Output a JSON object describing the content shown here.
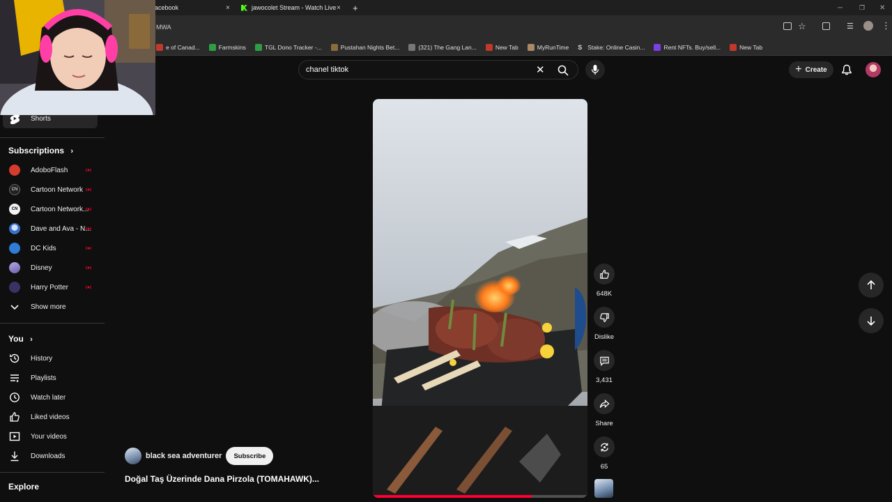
{
  "browser": {
    "tabs": [
      {
        "label": "acebook",
        "close": "×"
      },
      {
        "label": "jawocolet Stream - Watch Live",
        "close": "×"
      }
    ],
    "new_tab": "+",
    "address_partial": "MWA",
    "bookmarks": [
      {
        "label": "e of Canad...",
        "color": "#c0392b"
      },
      {
        "label": "Farmskins",
        "color": "#2e9e45"
      },
      {
        "label": "TGL Dono Tracker -...",
        "color": "#2e9e45"
      },
      {
        "label": "Pustahan Nights Bet...",
        "color": "#8a6d3b"
      },
      {
        "label": "(321) The Gang Lan...",
        "color": "#777777"
      },
      {
        "label": "New Tab",
        "color": "#c0392b"
      },
      {
        "label": "MyRunTime",
        "color": "#aa8866"
      },
      {
        "label": "Stake: Online Casin...",
        "color": "#dddddd"
      },
      {
        "label": "Rent NFTs. Buy/sell...",
        "color": "#7b3fe4"
      },
      {
        "label": "New Tab",
        "color": "#c0392b"
      }
    ]
  },
  "header": {
    "search_query": "chanel tiktok",
    "clear": "✕",
    "create_label": "Create",
    "create_plus": "+"
  },
  "sidebar": {
    "shorts_label": "Shorts",
    "subscriptions_title": "Subscriptions",
    "subscriptions": [
      {
        "label": "AdoboFlash",
        "color": "#d63b2f"
      },
      {
        "label": "Cartoon Network",
        "color": "#222222"
      },
      {
        "label": "Cartoon Network...",
        "color": "#f2f2f2"
      },
      {
        "label": "Dave and Ava - N...",
        "color": "#3b6fc9"
      },
      {
        "label": "DC Kids",
        "color": "#2f7bd6"
      },
      {
        "label": "Disney",
        "color": "#8f7ec6"
      },
      {
        "label": "Harry Potter",
        "color": "#3b3264"
      }
    ],
    "show_more": "Show more",
    "you_title": "You",
    "you_items": [
      {
        "label": "History",
        "icon": "history-icon"
      },
      {
        "label": "Playlists",
        "icon": "playlists-icon"
      },
      {
        "label": "Watch later",
        "icon": "watch-later-icon"
      },
      {
        "label": "Liked videos",
        "icon": "like-icon"
      },
      {
        "label": "Your videos",
        "icon": "your-videos-icon"
      },
      {
        "label": "Downloads",
        "icon": "download-icon"
      }
    ],
    "explore_title": "Explore",
    "accent": "#ff0033"
  },
  "short": {
    "channel": "black sea adventurer",
    "subscribe_label": "Subscribe",
    "title": "Doğal Taş Üzerinde Dana Pirzola (TOMAHAWK)...",
    "likes": "648K",
    "dislike_label": "Dislike",
    "comments": "3,431",
    "share_label": "Share",
    "remix_count": "65",
    "progress_color": "#ff0033"
  }
}
